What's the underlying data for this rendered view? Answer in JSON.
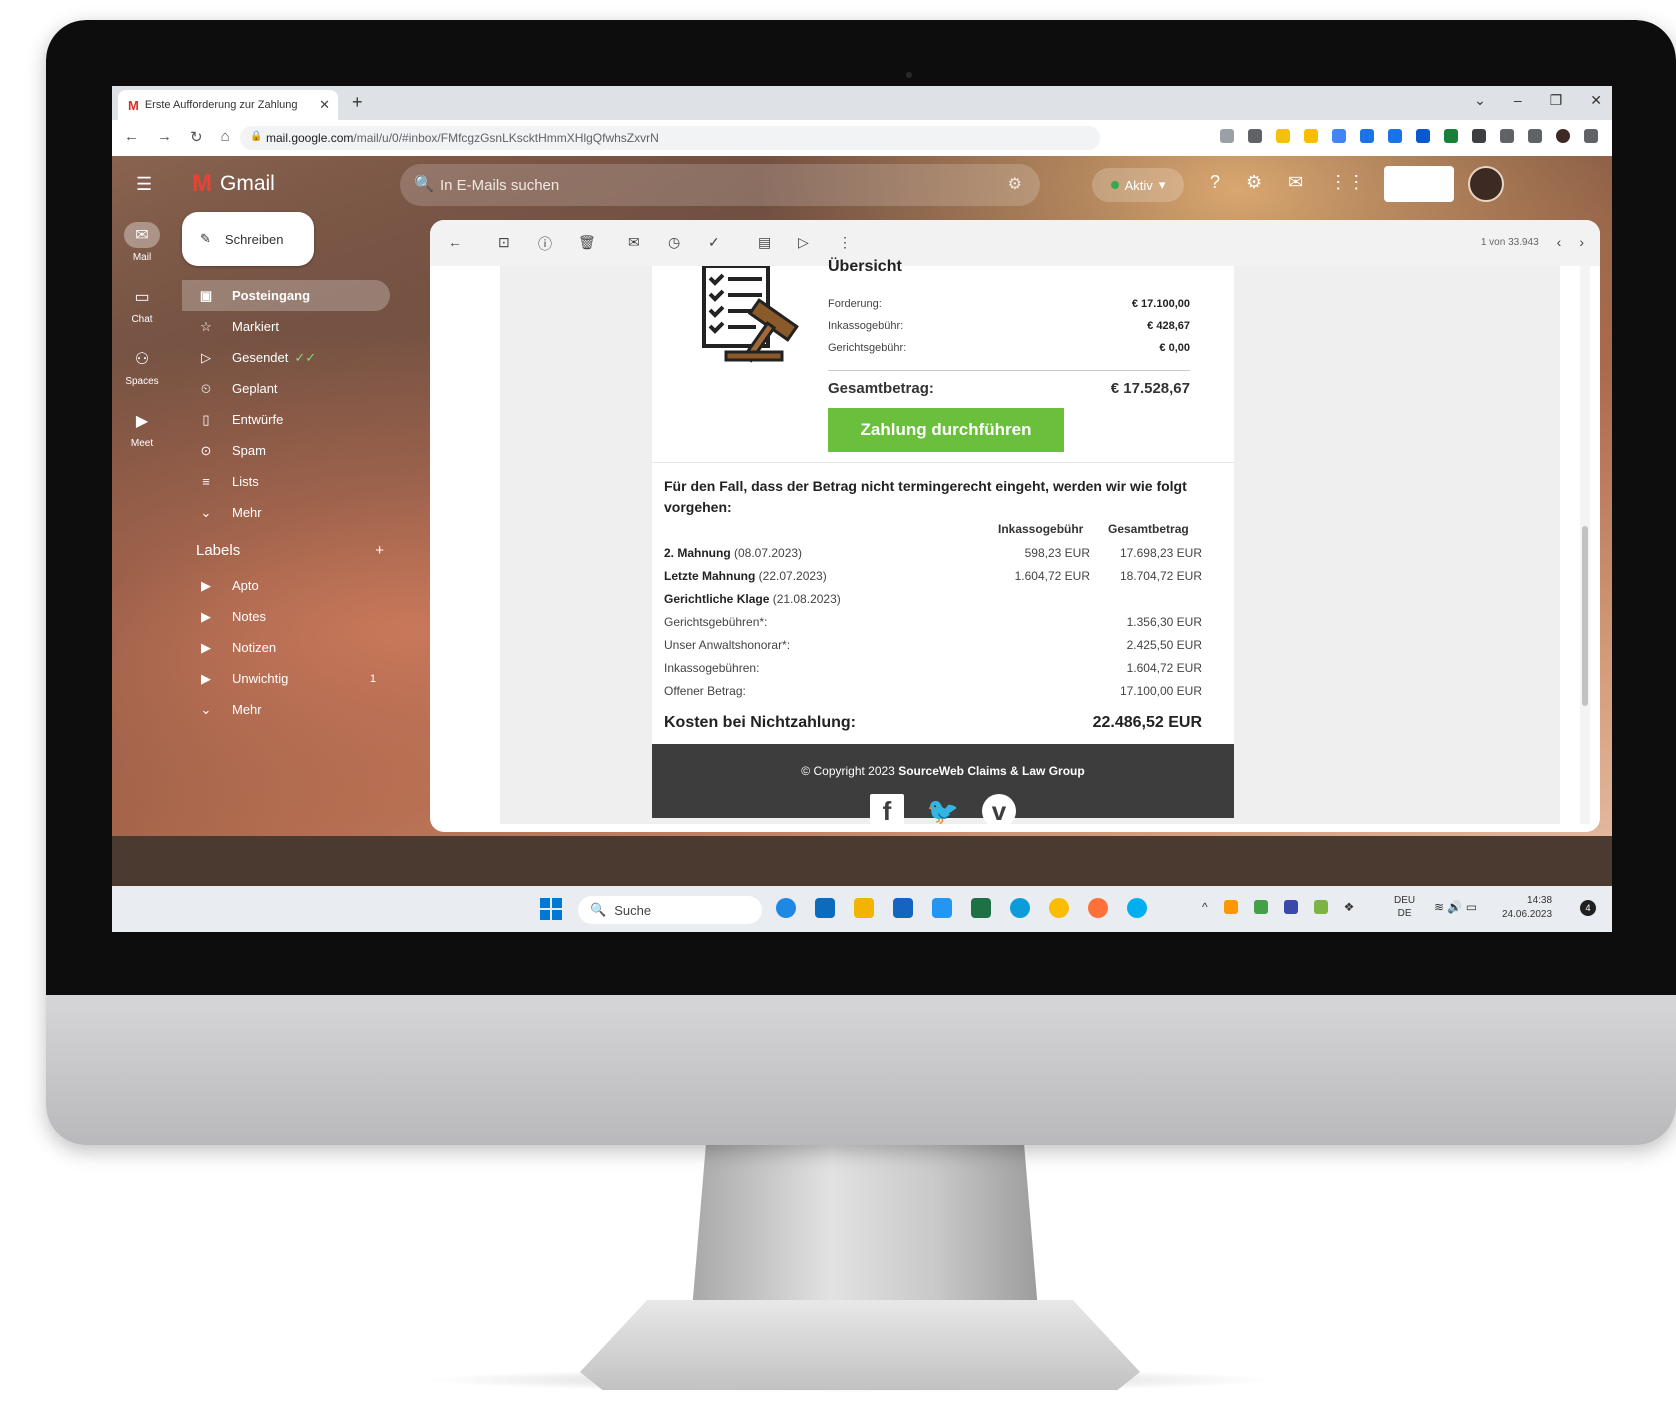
{
  "browser": {
    "tab_title": "Erste Aufforderung zur Zahlung",
    "new_tab": "+",
    "url_host": "mail.google.com",
    "url_path": "/mail/u/0/#inbox/FMfcgzGsnLKscktHmmXHlgQfwhsZxvrN"
  },
  "gmail": {
    "brand": "Gmail",
    "search_placeholder": "In E-Mails suchen",
    "status": "Aktiv",
    "compose": "Schreiben",
    "rail": [
      "Mail",
      "Chat",
      "Spaces",
      "Meet"
    ],
    "nav": [
      {
        "label": "Posteingang",
        "icon": "inbox-icon"
      },
      {
        "label": "Markiert",
        "icon": "star-icon"
      },
      {
        "label": "Gesendet",
        "icon": "send-icon"
      },
      {
        "label": "Geplant",
        "icon": "scheduled-icon"
      },
      {
        "label": "Entwürfe",
        "icon": "draft-icon"
      },
      {
        "label": "Spam",
        "icon": "spam-icon"
      },
      {
        "label": "Lists",
        "icon": "list-icon"
      },
      {
        "label": "Mehr",
        "icon": "chevron-down-icon"
      }
    ],
    "labels_title": "Labels",
    "labels_add": "+",
    "labels": [
      {
        "label": "Apto",
        "count": ""
      },
      {
        "label": "Notes",
        "count": ""
      },
      {
        "label": "Notizen",
        "count": ""
      },
      {
        "label": "Unwichtig",
        "count": "1"
      },
      {
        "label": "Mehr",
        "count": ""
      }
    ],
    "pager": "1 von 33.943"
  },
  "email": {
    "overview_title": "Übersicht",
    "summary": [
      {
        "label": "Forderung:",
        "value": "€    17.100,00"
      },
      {
        "label": "Inkassogebühr:",
        "value": "€        428,67"
      },
      {
        "label": "Gerichtsgebühr:",
        "value": "€            0,00"
      }
    ],
    "total_label": "Gesamtbetrag:",
    "total_value": "€ 17.528,67",
    "pay_button": "Zahlung durchführen",
    "intro": "Für den Fall, dass der Betrag nicht termingerecht eingeht, werden wir wie folgt vorgehen:",
    "col1": "Inkassogebühr",
    "col2": "Gesamtbetrag",
    "rows": [
      {
        "bold": "2. Mahnung",
        "rest": " (08.07.2023)",
        "c1": "598,23 EUR",
        "c2": "17.698,23 EUR"
      },
      {
        "bold": "Letzte Mahnung",
        "rest": " (22.07.2023)",
        "c1": "1.604,72 EUR",
        "c2": "18.704,72 EUR"
      },
      {
        "bold": "Gerichtliche Klage",
        "rest": " (21.08.2023)",
        "c1": "",
        "c2": ""
      },
      {
        "bold": "",
        "rest": "Gerichtsgebühren*:",
        "c1": "",
        "c2": "1.356,30 EUR"
      },
      {
        "bold": "",
        "rest": "Unser Anwaltshonorar*:",
        "c1": "",
        "c2": "2.425,50 EUR"
      },
      {
        "bold": "",
        "rest": "Inkassogebühren:",
        "c1": "",
        "c2": "1.604,72 EUR"
      },
      {
        "bold": "",
        "rest": "Offener Betrag:",
        "c1": "",
        "c2": "17.100,00 EUR"
      }
    ],
    "kosten_label": "Kosten bei Nichtzahlung:",
    "kosten_value": "22.486,52 EUR",
    "copyright_prefix": "© Copyright 2023 ",
    "copyright_company": "SourceWeb Claims & Law Group",
    "social": [
      "f",
      "t",
      "v"
    ]
  },
  "taskbar": {
    "search_label": "Suche",
    "lang_top": "DEU",
    "lang_bottom": "DE",
    "time": "14:38",
    "date": "24.06.2023",
    "notifications": "4"
  },
  "colors": {
    "pay_button": "#6abf3c",
    "footer": "#3d3d3d",
    "gmail_red": "#ea4335"
  }
}
